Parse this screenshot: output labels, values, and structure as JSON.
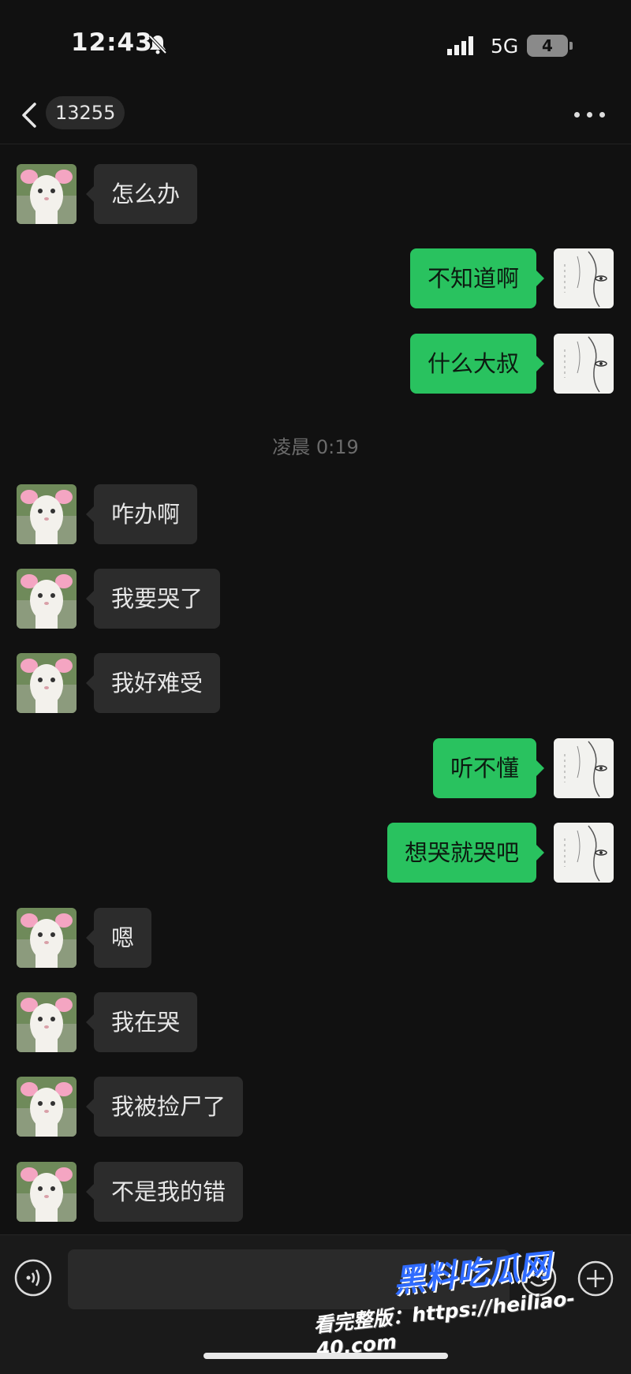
{
  "status_bar": {
    "time": "12:43",
    "network": "5G",
    "battery": "4"
  },
  "header": {
    "contact": "13255"
  },
  "messages": [
    {
      "side": "in",
      "text": "怎么办"
    },
    {
      "side": "out",
      "text": "不知道啊"
    },
    {
      "side": "out",
      "text": "什么大叔"
    },
    {
      "type": "time",
      "text": "凌晨 0:19"
    },
    {
      "side": "in",
      "text": "咋办啊"
    },
    {
      "side": "in",
      "text": "我要哭了"
    },
    {
      "side": "in",
      "text": "我好难受"
    },
    {
      "side": "out",
      "text": "听不懂"
    },
    {
      "side": "out",
      "text": "想哭就哭吧"
    },
    {
      "side": "in",
      "text": "嗯"
    },
    {
      "side": "in",
      "text": "我在哭"
    },
    {
      "side": "in",
      "text": "我被捡尸了"
    },
    {
      "side": "in",
      "text": "不是我的错"
    }
  ],
  "input": {
    "value": ""
  },
  "watermark": {
    "brand": "黑料吃瓜网",
    "url_text": "看完整版：https://heiliao-40.com"
  },
  "colors": {
    "outgoing_bubble": "#29c25f",
    "incoming_bubble": "#2c2c2c",
    "background": "#111111"
  },
  "icons": [
    "back-chevron-icon",
    "more-icon",
    "voice-icon",
    "emoji-icon",
    "plus-icon",
    "mute-bell-icon",
    "signal-icon"
  ]
}
